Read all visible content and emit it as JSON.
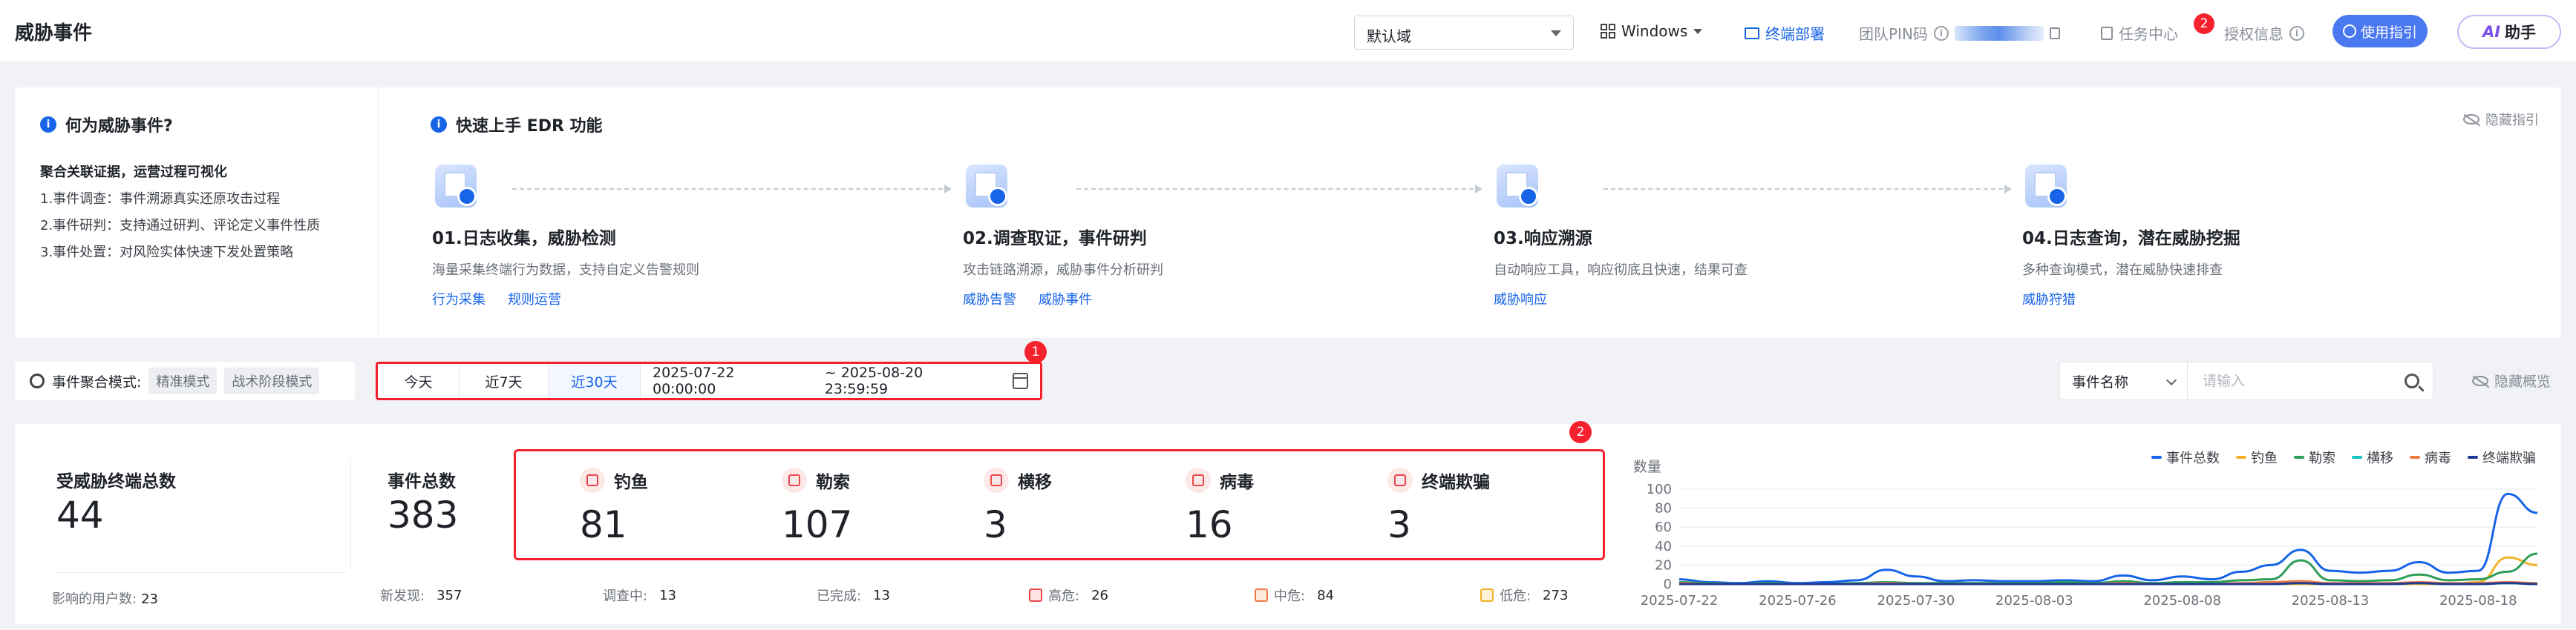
{
  "header": {
    "title": "威胁事件",
    "domain_select": "默认域",
    "os_select": "Windows",
    "deploy_label": "终端部署",
    "pin_label": "团队PIN码",
    "task_center": "任务中心",
    "task_badge": "2",
    "license_info": "授权信息",
    "guide_label": "使用指引",
    "ai_prefix": "AI",
    "ai_label": "助手",
    "accent_color": "#1764e8"
  },
  "intro": {
    "left_title": "何为威胁事件?",
    "lead": "聚合关联证据，运营过程可视化",
    "lines": [
      "1.事件调查：事件溯源真实还原攻击过程",
      "2.事件研判：支持通过研判、评论定义事件性质",
      "3.事件处置：对风险实体快速下发处置策略"
    ],
    "right_title": "快速上手 EDR 功能",
    "hide_label": "隐藏指引",
    "steps": [
      {
        "title": "01.日志收集，威胁检测",
        "desc": "海量采集终端行为数据，支持自定义告警规则",
        "links": [
          "行为采集",
          "规则运营"
        ],
        "icon": "collect-icon"
      },
      {
        "title": "02.调查取证，事件研判",
        "desc": "攻击链路溯源，威胁事件分析研判",
        "links": [
          "威胁告警",
          "威胁事件"
        ],
        "icon": "investigate-icon"
      },
      {
        "title": "03.响应溯源",
        "desc": "自动响应工具，响应彻底且快速，结果可查",
        "links": [
          "威胁响应"
        ],
        "icon": "response-icon"
      },
      {
        "title": "04.日志查询，潜在威胁挖掘",
        "desc": "多种查询模式，潜在威胁快速排查",
        "links": [
          "威胁狩猎"
        ],
        "icon": "hunting-icon"
      }
    ]
  },
  "filters": {
    "mode_label": "事件聚合模式:",
    "mode_options": [
      "精准模式",
      "战术阶段模式"
    ],
    "date_tabs": [
      "今天",
      "近7天",
      "近30天"
    ],
    "active_tab": "近30天",
    "range_start": "2025-07-22 00:00:00",
    "range_end": "~ 2025-08-20 23:59:59",
    "badge_1": "1",
    "badge_2": "2",
    "search_field": "事件名称",
    "search_placeholder": "请输入",
    "hide_overview": "隐藏概览"
  },
  "stats": {
    "endpoints_label": "受威胁终端总数",
    "endpoints_value": "44",
    "users_label": "影响的用户数:",
    "users_value": "23",
    "events_label": "事件总数",
    "events_value": "383",
    "categories": [
      {
        "name": "钓鱼",
        "value": "81",
        "icon": "phishing-icon"
      },
      {
        "name": "勒索",
        "value": "107",
        "icon": "ransomware-icon"
      },
      {
        "name": "横移",
        "value": "3",
        "icon": "lateral-icon"
      },
      {
        "name": "病毒",
        "value": "16",
        "icon": "virus-icon"
      },
      {
        "name": "终端欺骗",
        "value": "3",
        "icon": "deception-icon"
      }
    ],
    "footer": [
      {
        "label": "新发现:",
        "value": "357"
      },
      {
        "label": "调查中:",
        "value": "13"
      },
      {
        "label": "已完成:",
        "value": "13"
      },
      {
        "label": "高危:",
        "value": "26",
        "level": "high"
      },
      {
        "label": "中危:",
        "value": "84",
        "level": "mid"
      },
      {
        "label": "低危:",
        "value": "273",
        "level": "low"
      }
    ],
    "status_colors": {
      "high": "#e8484d",
      "mid": "#f07a44",
      "low": "#f2b32a"
    }
  },
  "chart_data": {
    "type": "line",
    "ylabel": "数量",
    "ylim": [
      0,
      100
    ],
    "yticks": [
      0,
      20,
      40,
      60,
      80,
      100
    ],
    "xticks": [
      "2025-07-22",
      "2025-07-26",
      "2025-07-30",
      "2025-08-03",
      "2025-08-08",
      "2025-08-13",
      "2025-08-18"
    ],
    "legend_position": "top-right",
    "grid": true,
    "x": [
      0,
      1,
      2,
      3,
      4,
      5,
      6,
      7,
      8,
      9,
      10,
      11,
      12,
      13,
      14,
      15,
      16,
      17,
      18,
      19,
      20,
      21,
      22,
      23,
      24,
      25,
      26,
      27,
      28,
      29
    ],
    "series": [
      {
        "name": "事件总数",
        "color": "#1764e8",
        "values": [
          5,
          2,
          1,
          3,
          1,
          2,
          4,
          15,
          8,
          3,
          4,
          3,
          3,
          4,
          3,
          9,
          4,
          8,
          5,
          13,
          20,
          36,
          14,
          12,
          14,
          23,
          12,
          14,
          95,
          75
        ]
      },
      {
        "name": "钓鱼",
        "color": "#f2b32a",
        "values": [
          0,
          0,
          0,
          0,
          0,
          0,
          0,
          0,
          0,
          0,
          0,
          0,
          0,
          0,
          0,
          0,
          0,
          0,
          0,
          0,
          0,
          0,
          0,
          0,
          0,
          0,
          0,
          2,
          28,
          20
        ]
      },
      {
        "name": "勒索",
        "color": "#2f9e5a",
        "values": [
          2,
          1,
          0,
          1,
          0,
          0,
          1,
          2,
          1,
          1,
          1,
          1,
          1,
          2,
          1,
          3,
          1,
          2,
          2,
          4,
          5,
          25,
          4,
          3,
          4,
          10,
          4,
          5,
          13,
          32
        ]
      },
      {
        "name": "横移",
        "color": "#13c2c2",
        "values": [
          0,
          0,
          0,
          0,
          0,
          0,
          0,
          0,
          0,
          0,
          0,
          0,
          0,
          0,
          0,
          0,
          0,
          0,
          0,
          0,
          0,
          1,
          0,
          0,
          0,
          1,
          0,
          0,
          1,
          0
        ]
      },
      {
        "name": "病毒",
        "color": "#f07a44",
        "values": [
          1,
          0,
          0,
          0,
          0,
          0,
          0,
          1,
          0,
          0,
          0,
          0,
          0,
          0,
          0,
          1,
          0,
          0,
          0,
          1,
          2,
          3,
          1,
          1,
          1,
          2,
          1,
          1,
          2,
          1
        ]
      },
      {
        "name": "终端欺骗",
        "color": "#1f3a93",
        "values": [
          0,
          0,
          0,
          0,
          0,
          0,
          0,
          0,
          0,
          0,
          0,
          0,
          0,
          0,
          0,
          0,
          0,
          0,
          0,
          0,
          0,
          1,
          0,
          0,
          0,
          1,
          0,
          0,
          1,
          0
        ]
      }
    ]
  }
}
